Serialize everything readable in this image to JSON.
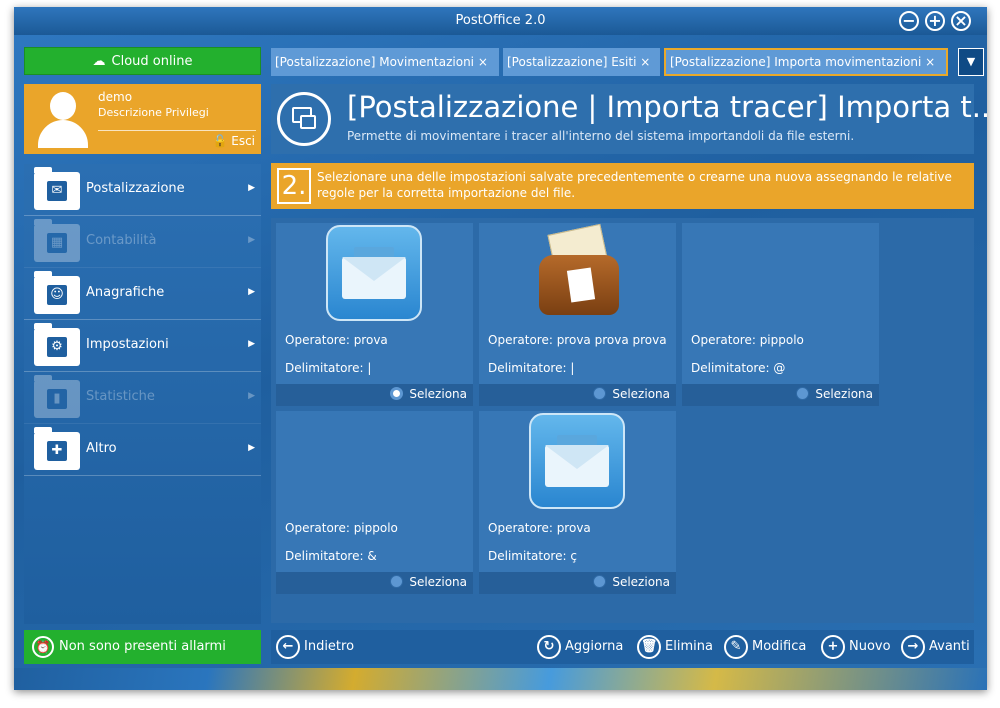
{
  "window": {
    "title": "PostOffice 2.0"
  },
  "sidebar": {
    "cloud_label": "Cloud online",
    "user": {
      "name": "demo",
      "privileges": "Descrizione Privilegi",
      "logout": "Esci"
    },
    "menu": [
      {
        "label": "Postalizzazione",
        "icon": "envelope-icon",
        "enabled": true
      },
      {
        "label": "Contabilità",
        "icon": "calculator-icon",
        "enabled": false
      },
      {
        "label": "Anagrafiche",
        "icon": "users-icon",
        "enabled": true
      },
      {
        "label": "Impostazioni",
        "icon": "gear-icon",
        "enabled": true
      },
      {
        "label": "Statistiche",
        "icon": "chart-icon",
        "enabled": false
      },
      {
        "label": "Altro",
        "icon": "puzzle-icon",
        "enabled": true
      }
    ],
    "alarm_label": "Non sono presenti allarmi"
  },
  "tabs": [
    {
      "label": "[Postalizzazione] Movimentazioni",
      "close": "×"
    },
    {
      "label": "[Postalizzazione] Esiti",
      "close": "×"
    },
    {
      "label": "[Postalizzazione] Importa movimentazioni",
      "close": "×"
    }
  ],
  "header": {
    "title": "[Postalizzazione | Importa tracer] Importa t...",
    "subtitle": "Permette di movimentare i tracer all'interno del sistema importandoli da file esterni."
  },
  "step": {
    "number": "2.",
    "text": "Selezionare una delle impostazioni salvate precedentemente o crearne una nuova assegnando le relative regole per la corretta importazione del file."
  },
  "cards": [
    {
      "operatore": "Operatore: prova",
      "delimitatore": "Delimitatore: |",
      "select": "Seleziona",
      "selected": true,
      "icon": "envelope"
    },
    {
      "operatore": "Operatore: prova prova prova",
      "delimitatore": "Delimitatore: |",
      "select": "Seleziona",
      "selected": false,
      "icon": "mailbag"
    },
    {
      "operatore": "Operatore: pippolo",
      "delimitatore": "Delimitatore: @",
      "select": "Seleziona",
      "selected": false,
      "icon": "none"
    },
    {
      "operatore": "Operatore: pippolo",
      "delimitatore": "Delimitatore: &",
      "select": "Seleziona",
      "selected": false,
      "icon": "none"
    },
    {
      "operatore": "Operatore: prova",
      "delimitatore": "Delimitatore: ç",
      "select": "Seleziona",
      "selected": false,
      "icon": "envelope"
    }
  ],
  "bottom": {
    "back": "Indietro",
    "refresh": "Aggiorna",
    "delete": "Elimina",
    "edit": "Modifica",
    "new": "Nuovo",
    "next": "Avanti"
  },
  "colors": {
    "green": "#23b02e",
    "orange": "#eaa52a",
    "blue": "#1f5f9f"
  }
}
